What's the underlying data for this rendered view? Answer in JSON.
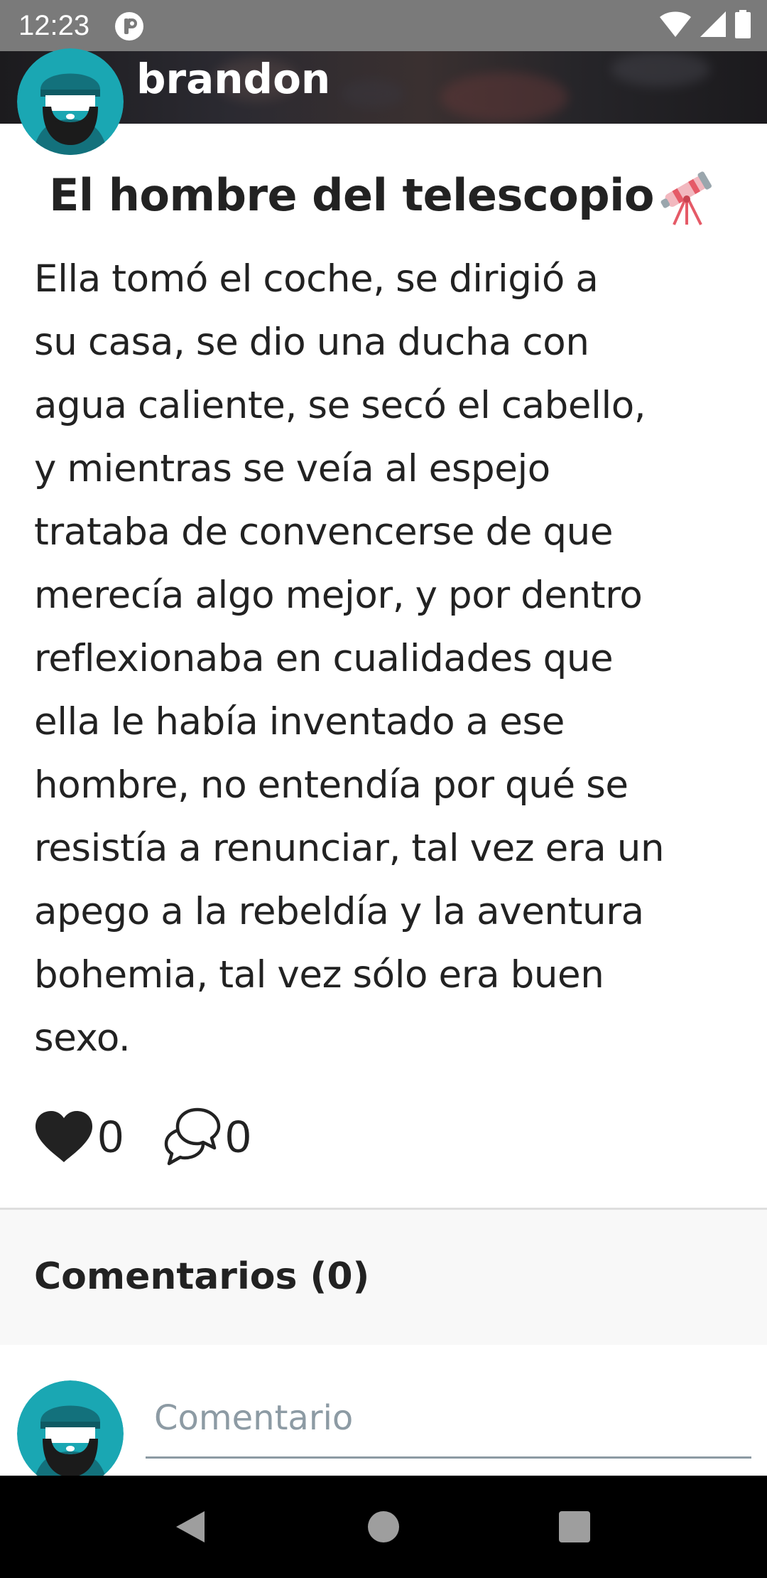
{
  "status_bar": {
    "time": "12:23",
    "icons": [
      "app-notification-icon",
      "wifi-icon",
      "cell-signal-icon",
      "battery-icon"
    ]
  },
  "header": {
    "username": "brandon",
    "avatar_icon": "bearded-man-avatar"
  },
  "post": {
    "title": "El hombre del telescopio",
    "title_emoji_icon": "telescope-icon",
    "body_lines": [
      "Ella tomó el coche, se dirigió a",
      "su casa, se dio una ducha con",
      "agua caliente, se secó el cabello,",
      "y mientras se veía al espejo",
      "trataba de convencerse de que",
      "merecía algo mejor, y por dentro",
      "reflexionaba en cualidades que",
      "ella le había inventado a ese",
      "hombre, no entendía por qué se",
      "resistía a renunciar, tal vez era un",
      "apego a la rebeldía y la aventura",
      "bohemia, tal vez sólo era buen",
      "sexo."
    ],
    "likes": "0",
    "comments": "0"
  },
  "comments": {
    "heading": "Comentarios (0)",
    "input_placeholder": "Comentario",
    "input_value": ""
  },
  "nav_bar": {
    "buttons": [
      "back-icon",
      "home-icon",
      "recents-icon"
    ]
  },
  "colors": {
    "status_bar": "#7a7a7a",
    "avatar_teal": "#1aa7b3",
    "comments_bg": "#f8f8f8",
    "text": "#222222",
    "placeholder": "#8d9ba4"
  }
}
